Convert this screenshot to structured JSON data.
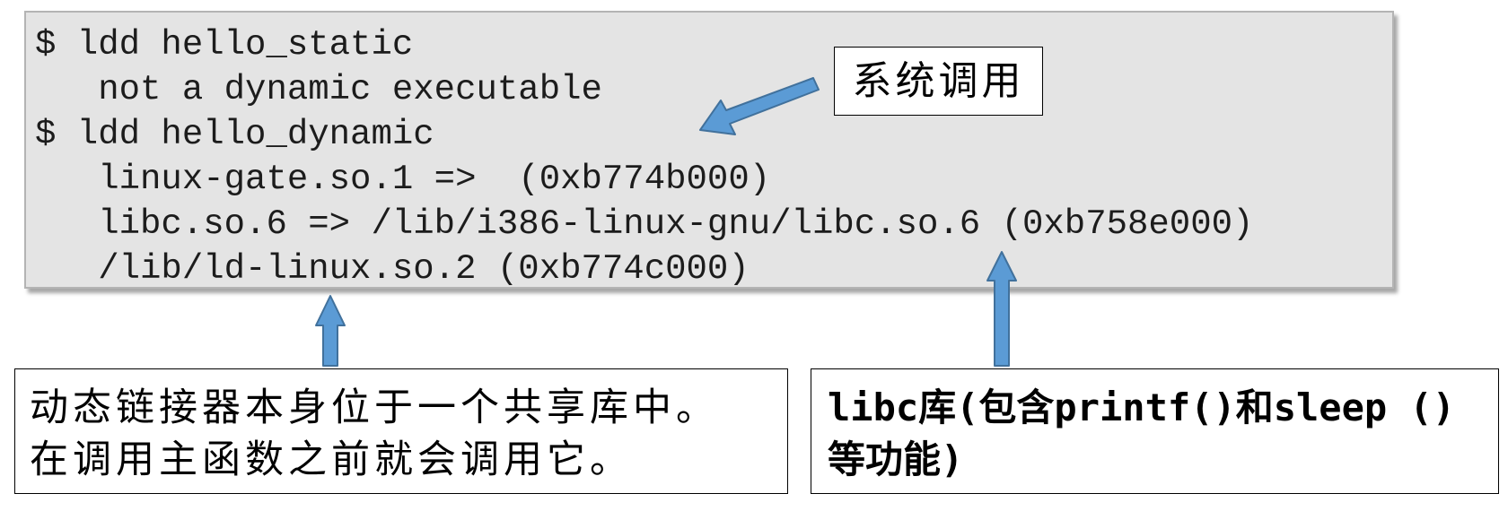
{
  "terminal": {
    "lines": [
      "$ ldd hello_static",
      "   not a dynamic executable",
      "$ ldd hello_dynamic",
      "   linux-gate.so.1 =>  (0xb774b000)",
      "   libc.so.6 => /lib/i386-linux-gnu/libc.so.6 (0xb758e000)",
      "   /lib/ld-linux.so.2 (0xb774c000)"
    ]
  },
  "callouts": {
    "syscall": "系统调用",
    "dynamic_linker": [
      "动态链接器本身位于一个共享库中。",
      "在调用主函数之前就会调用它。"
    ],
    "libc": [
      "libc库(包含printf()和sleep ()",
      "等功能)"
    ]
  },
  "colors": {
    "arrow_fill": "#5b9bd5",
    "arrow_stroke": "#41719c",
    "terminal_bg": "#e4e4e4"
  }
}
